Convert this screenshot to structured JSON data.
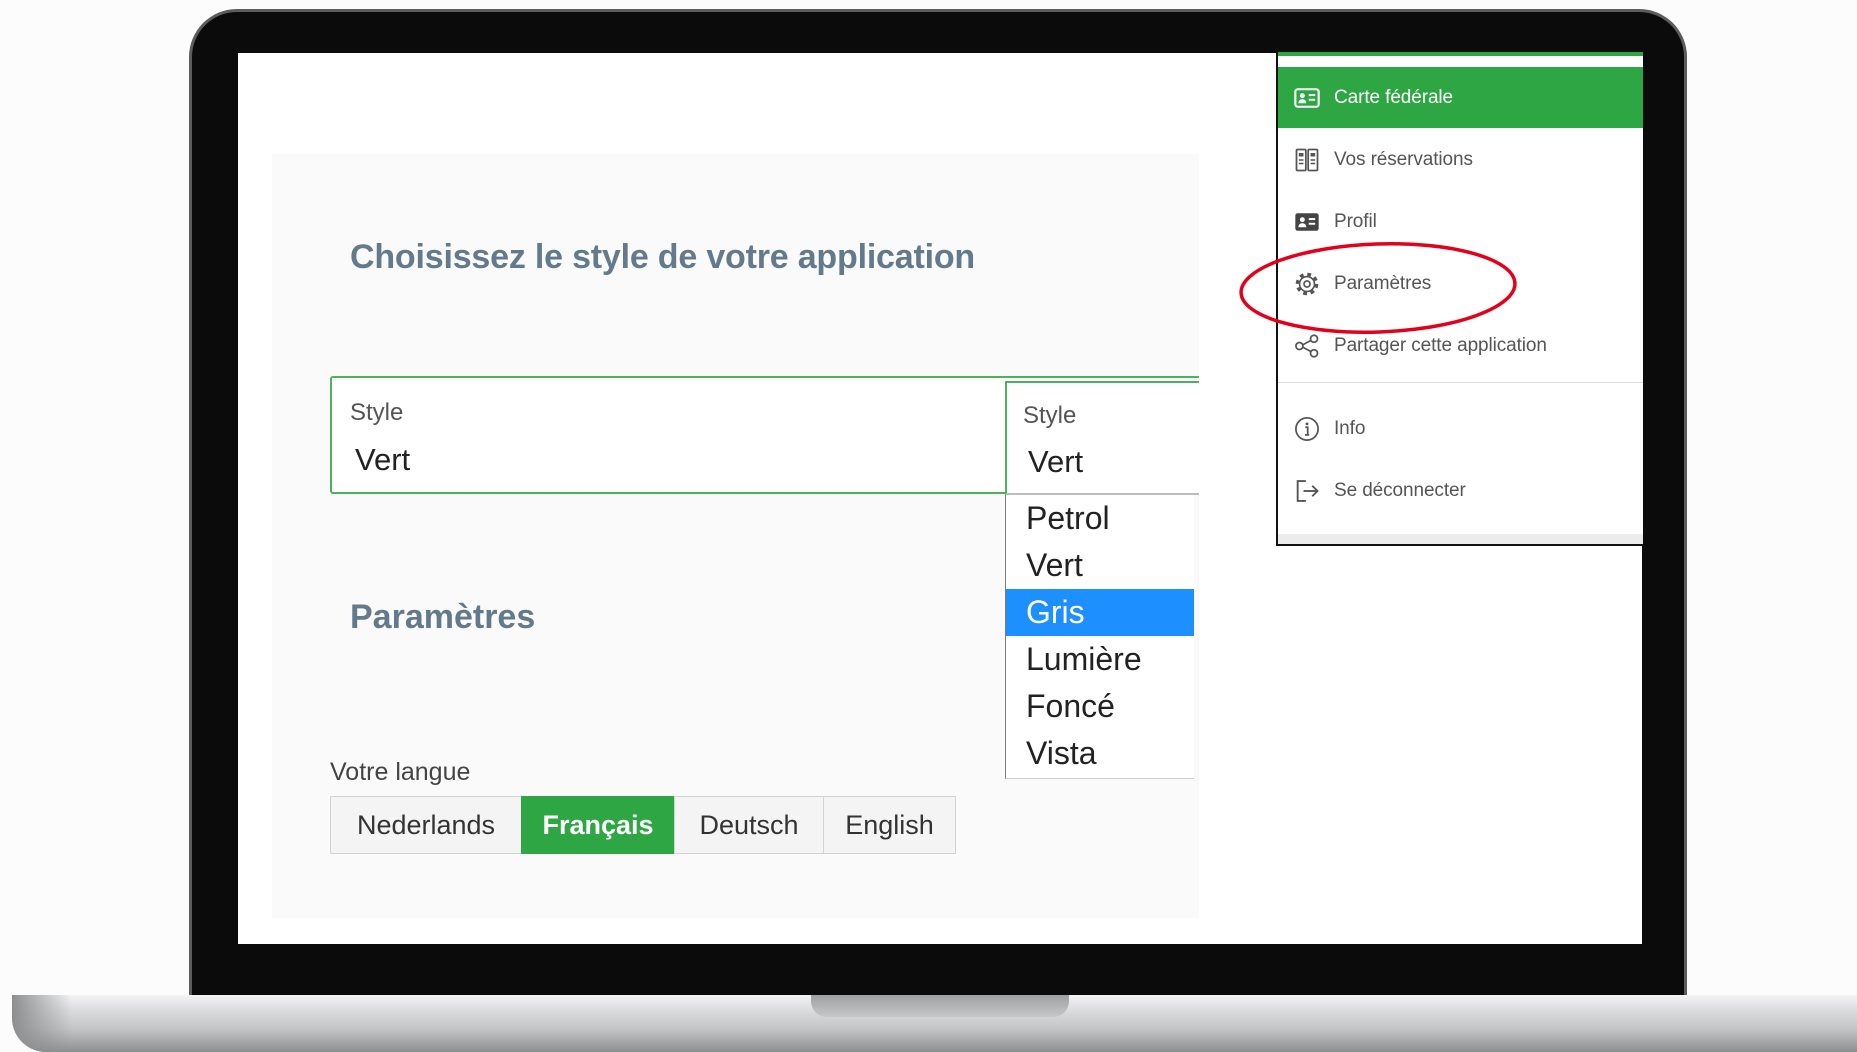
{
  "heading": "Choisissez le style de votre application",
  "style_field": {
    "label": "Style",
    "value": "Vert"
  },
  "style_select": {
    "label": "Style",
    "value": "Vert",
    "options": [
      "Petrol",
      "Vert",
      "Gris",
      "Lumière",
      "Foncé",
      "Vista"
    ],
    "highlighted_index": 2
  },
  "settings_heading": "Paramètres",
  "language": {
    "label": "Votre langue",
    "options": [
      "Nederlands",
      "Français",
      "Deutsch",
      "English"
    ],
    "selected_index": 1
  },
  "menu": {
    "items": [
      {
        "label": "Carte fédérale",
        "icon": "id-card-icon",
        "active": true
      },
      {
        "label": "Vos réservations",
        "icon": "reservations-icon",
        "active": false
      },
      {
        "label": "Profil",
        "icon": "profile-card-icon",
        "active": false
      },
      {
        "label": "Paramètres",
        "icon": "gear-icon",
        "active": false,
        "circled": true
      },
      {
        "label": "Partager cette application",
        "icon": "share-icon",
        "active": false
      }
    ],
    "secondary_items": [
      {
        "label": "Info",
        "icon": "info-icon"
      },
      {
        "label": "Se déconnecter",
        "icon": "logout-icon"
      }
    ]
  },
  "colors": {
    "accent_green": "#2ea643",
    "field_border_green": "#4cb35a",
    "selected_option_blue": "#1e8fff",
    "heading": "#627a8b",
    "annotation_red": "#e3001b"
  }
}
